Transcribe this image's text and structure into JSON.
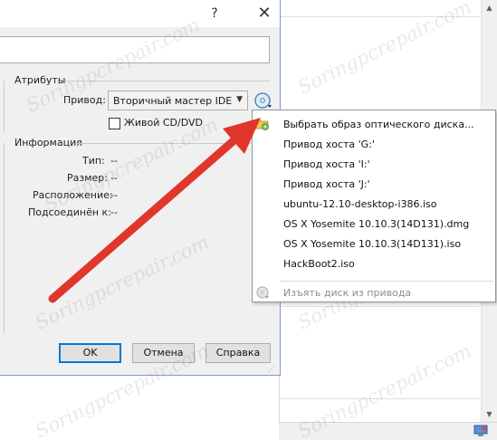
{
  "dialog": {
    "help_glyph": "?",
    "close_glyph": "✕",
    "attributes_group": "Атрибуты",
    "drive_label": "Привод:",
    "drive_value": "Вторичный мастер IDE",
    "live_cd_label": "Живой CD/DVD",
    "live_cd_checked": false,
    "info_group": "Информация",
    "info_rows": [
      {
        "label": "Тип:",
        "value": "--"
      },
      {
        "label": "Размер:",
        "value": "--"
      },
      {
        "label": "Расположение:",
        "value": "--"
      },
      {
        "label": "Подсоединён к:",
        "value": "--"
      }
    ],
    "ok_label": "OK",
    "cancel_label": "Отмена",
    "help_label": "Справка"
  },
  "menu": {
    "items": [
      {
        "label": "Выбрать образ оптического диска...",
        "icon": "folder-disk-icon",
        "disabled": false
      },
      {
        "label": "Привод хоста 'G:'",
        "icon": "",
        "disabled": false
      },
      {
        "label": "Привод хоста 'I:'",
        "icon": "",
        "disabled": false
      },
      {
        "label": "Привод хоста 'J:'",
        "icon": "",
        "disabled": false
      },
      {
        "label": "ubuntu-12.10-desktop-i386.iso",
        "icon": "",
        "disabled": false
      },
      {
        "label": "OS X Yosemite 10.10.3(14D131).dmg",
        "icon": "",
        "disabled": false
      },
      {
        "label": "OS X Yosemite 10.10.3(14D131).iso",
        "icon": "",
        "disabled": false
      },
      {
        "label": "HackBoot2.iso",
        "icon": "",
        "disabled": false
      }
    ],
    "remove_item": {
      "label": "Изъять диск из привода",
      "icon": "eject-disk-icon",
      "disabled": true
    }
  },
  "watermark": {
    "text": "Soringpcrepair.com"
  },
  "colors": {
    "arrow": "#e0362c",
    "accent": "#0078d7"
  }
}
